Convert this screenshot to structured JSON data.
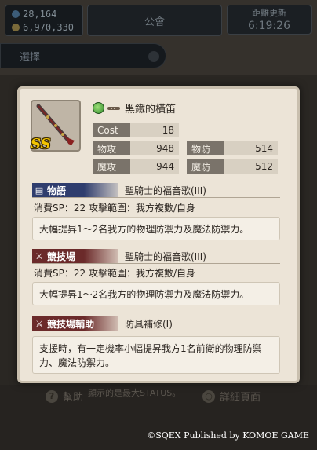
{
  "top": {
    "stat_1": "28,164",
    "stat_2": "6,970,330",
    "center_label": "公會",
    "right_label": "距離更新",
    "right_time": "6:19:26",
    "select_label": "選擇"
  },
  "equipment": {
    "rank": "SS",
    "name": "黑鐵的橫笛",
    "stats": {
      "cost_label": "Cost",
      "cost_value": "18",
      "patk_label": "物攻",
      "patk_value": "948",
      "pdef_label": "物防",
      "pdef_value": "514",
      "matk_label": "魔攻",
      "matk_value": "944",
      "mdef_label": "魔防",
      "mdef_value": "512"
    }
  },
  "sections": [
    {
      "tag": "物語",
      "tag_color": "#2f3d6e",
      "skill_name": "聖騎士的福音歌(III)",
      "meta": "消費SP：22 攻擊範圍：我方複數/自身",
      "desc": "大幅提昇1～2名我方的物理防禦力及魔法防禦力。"
    },
    {
      "tag": "競技場",
      "tag_color": "#6b2a2a",
      "skill_name": "聖騎士的福音歌(III)",
      "meta": "消費SP：22 攻擊範圍：我方複數/自身",
      "desc": "大幅提昇1～2名我方的物理防禦力及魔法防禦力。"
    },
    {
      "tag": "競技場輔助",
      "tag_color": "#6b2a2a",
      "skill_name": "防具補修(I)",
      "desc_line1": "支援時，有一定機率小幅提昇我方1名前衛的物理防禦",
      "desc_line2": "力、魔法防禦力。"
    }
  ],
  "bottom": {
    "help_label": "幫助",
    "note": "顯示的是最大STATUS。",
    "detail_label": "詳細頁面",
    "copyright": "©SQEX Published by KOMOE GAME"
  }
}
